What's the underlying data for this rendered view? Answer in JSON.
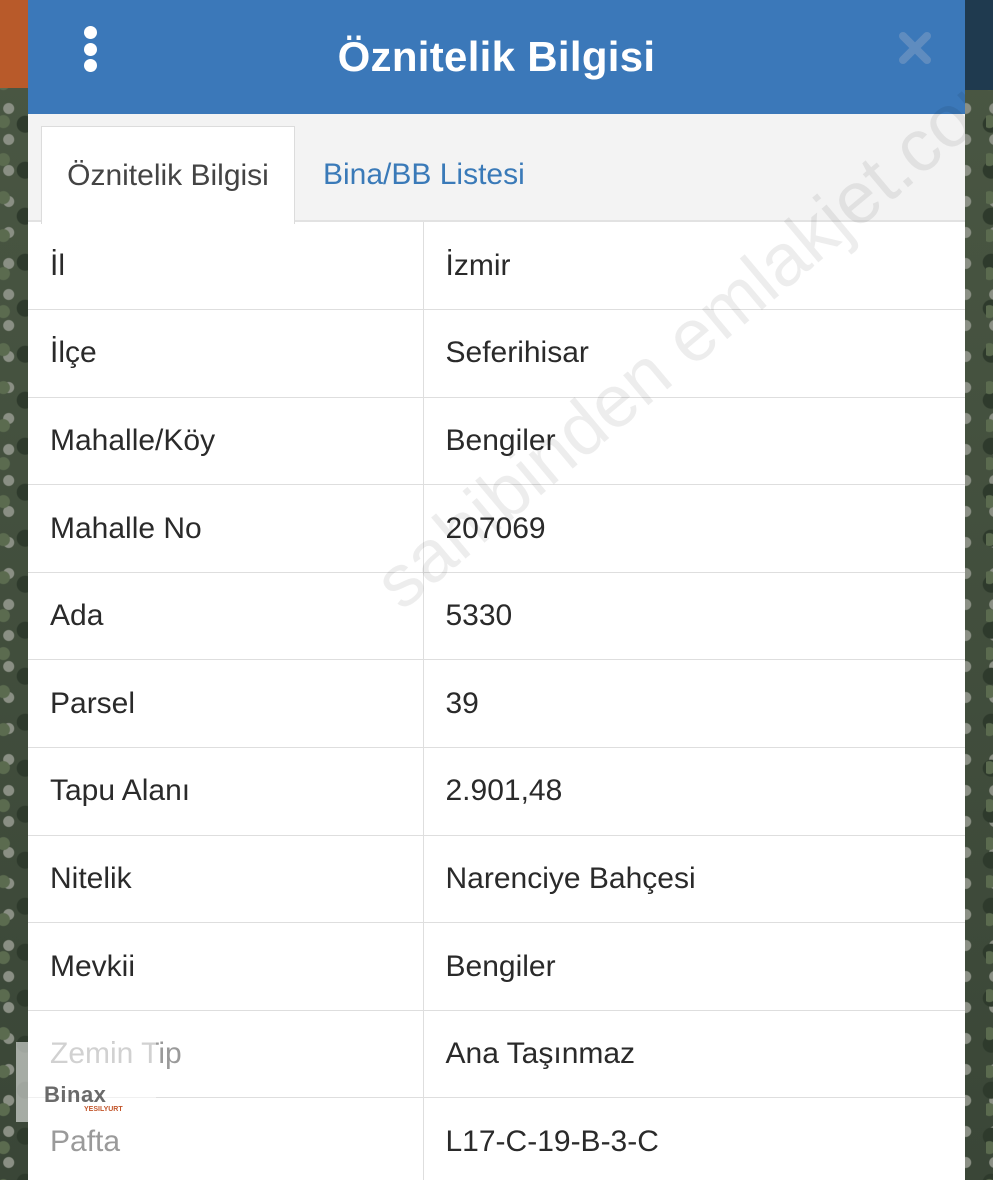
{
  "header": {
    "title": "Öznitelik Bilgisi",
    "menu_icon": "kebab-menu-icon",
    "close_icon": "close-icon",
    "accent_color": "#3b78b9"
  },
  "tabs": [
    {
      "label": "Öznitelik Bilgisi",
      "active": true
    },
    {
      "label": "Bina/BB Listesi",
      "active": false
    }
  ],
  "rows": [
    {
      "key": "İl",
      "value": "İzmir"
    },
    {
      "key": "İlçe",
      "value": "Seferihisar"
    },
    {
      "key": "Mahalle/Köy",
      "value": "Bengiler"
    },
    {
      "key": "Mahalle No",
      "value": "207069"
    },
    {
      "key": "Ada",
      "value": "5330"
    },
    {
      "key": "Parsel",
      "value": "39"
    },
    {
      "key": "Tapu Alanı",
      "value": "2.901,48"
    },
    {
      "key": "Nitelik",
      "value": "Narenciye Bahçesi"
    },
    {
      "key": "Mevkii",
      "value": "Bengiler"
    },
    {
      "key": "Zemin Tip",
      "value": "Ana Taşınmaz"
    },
    {
      "key": "Pafta",
      "value": "L17-C-19-B-3-C"
    }
  ],
  "watermark": "sahibinden emlakjet.com",
  "logo": {
    "text": "Binax",
    "sub": "YESILYURT"
  }
}
